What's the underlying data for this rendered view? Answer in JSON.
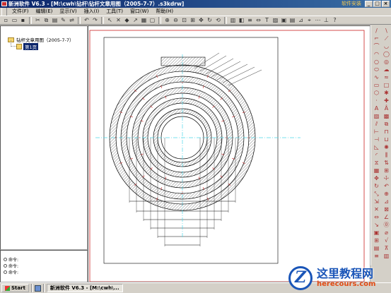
{
  "window": {
    "title": "新洲软件 V6.3 - [M:\\cwh\\钻杆\\钻杆文章用图（2005-7-7）.s3kdrw]",
    "watermark": "软件安装",
    "buttons": [
      "_",
      "□",
      "×"
    ]
  },
  "menu": {
    "items": [
      "文件(F)",
      "编辑(E)",
      "显示(V)",
      "插入(I)",
      "工具(T)",
      "窗口(W)",
      "帮助(H)"
    ]
  },
  "tree": {
    "root": "钻杆文章用图（2005-7-7）",
    "child": "第1页"
  },
  "command": {
    "lines": [
      "命令:",
      "命令:",
      "命令:"
    ]
  },
  "taskbar": {
    "start": "Start",
    "task": "新洲软件 V6.3 - [M:\\cwh\\..."
  },
  "logo": {
    "letter": "Z",
    "title": "这里教程网",
    "url": "herecours.com"
  },
  "colors": {
    "title_bar": "#0a246a",
    "selection": "#0a246a",
    "page_border": "#cc2222",
    "center_line": "#4fd8e8",
    "logo_blue": "#1a55b8",
    "logo_orange": "#e24a12"
  }
}
